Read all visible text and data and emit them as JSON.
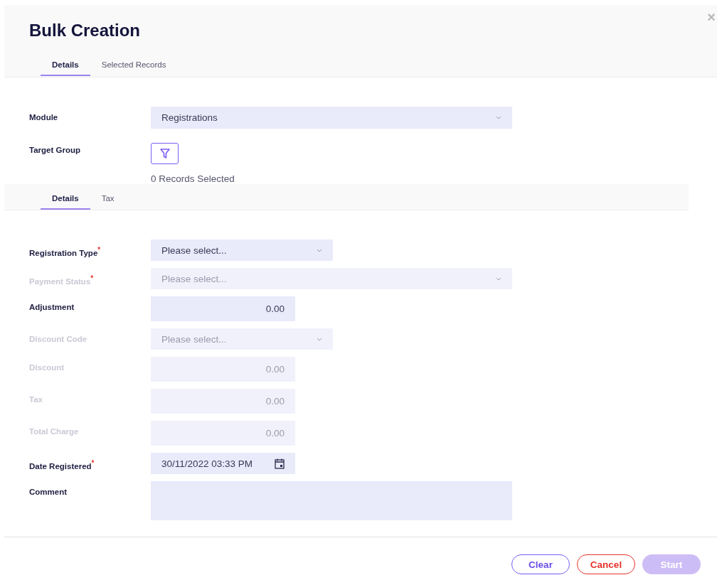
{
  "dialog": {
    "title": "Bulk Creation",
    "close": "×"
  },
  "tabs": [
    {
      "label": "Details",
      "selected": true
    },
    {
      "label": "Selected Records",
      "selected": false
    }
  ],
  "module": {
    "label": "Module",
    "value": "Registrations"
  },
  "target_group": {
    "label": "Target Group",
    "summary": "0 Records Selected"
  },
  "sub_tabs": [
    {
      "label": "Details",
      "selected": true
    },
    {
      "label": "Tax",
      "selected": false
    }
  ],
  "fields": [
    {
      "label": "Registration Type",
      "required_mark": "*",
      "kind": "select",
      "disabled": false,
      "placeholder": "Please select..."
    },
    {
      "label": "Payment Status",
      "required_mark": "*",
      "kind": "select",
      "disabled": true,
      "wide": true,
      "placeholder": "Please select..."
    },
    {
      "label": "Adjustment",
      "kind": "number",
      "disabled": false,
      "value": "0.00"
    },
    {
      "label": "Discount Code",
      "kind": "select",
      "disabled": true,
      "placeholder": "Please select..."
    },
    {
      "label": "Discount",
      "kind": "number",
      "disabled": true,
      "value": "0.00"
    },
    {
      "label": "Tax",
      "kind": "number",
      "disabled": true,
      "value": "0.00"
    },
    {
      "label": "Total Charge",
      "kind": "number",
      "disabled": true,
      "value": "0.00"
    },
    {
      "label": "Date Registered",
      "required_mark": "*",
      "kind": "date",
      "disabled": false,
      "value": "30/11/2022 03:33 PM"
    },
    {
      "label": "Comment",
      "kind": "textarea",
      "disabled": false,
      "wide": true
    }
  ],
  "buttons": [
    {
      "label": "Clear",
      "kind": "outline",
      "disabled": false
    },
    {
      "label": "Cancel",
      "kind": "danger",
      "disabled": false
    },
    {
      "label": "Start",
      "kind": "primary",
      "disabled": true
    }
  ]
}
